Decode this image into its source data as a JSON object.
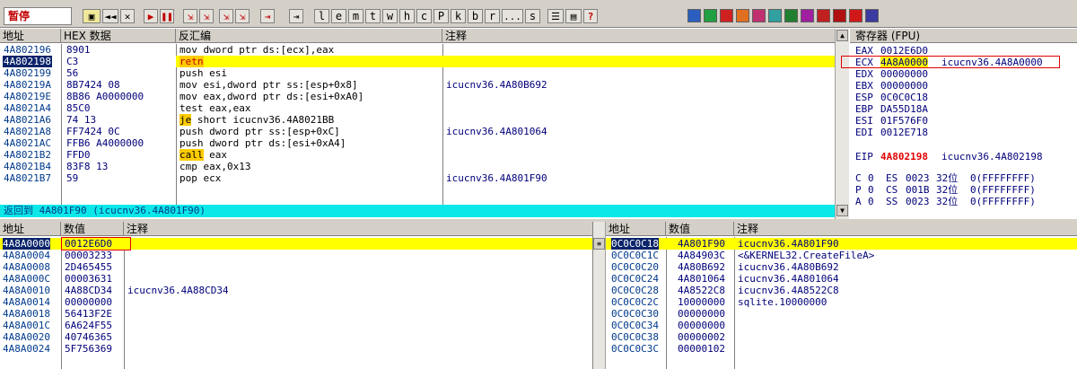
{
  "toolbar": {
    "status": "暂停",
    "buttons": [
      "◄◄",
      "✕",
      "▶",
      "❚❚",
      "⇲",
      "⇲",
      "⇲",
      "⇲",
      "⇥",
      "⇥"
    ],
    "letters": [
      "l",
      "e",
      "m",
      "t",
      "w",
      "h",
      "c",
      "P",
      "k",
      "b",
      "r",
      "...",
      "s"
    ],
    "help": "?"
  },
  "colors": {
    "highlight": "#ffff00",
    "selected": "#0a246a",
    "panel": "#d4d0c8",
    "address": "#003a8c",
    "red": "#e00000"
  },
  "disasm": {
    "headers": {
      "address": "地址",
      "hex": "HEX 数据",
      "disasm": "反汇编",
      "comment": "注释"
    },
    "rows": [
      {
        "addr": "4A802196",
        "hex": "8901",
        "asm": "mov dword ptr ds:[ecx],eax",
        "comment": ""
      },
      {
        "addr": "4A802198",
        "hex": "C3",
        "asm": "retn",
        "comment": ""
      },
      {
        "addr": "4A802199",
        "hex": "56",
        "asm": "push esi",
        "comment": ""
      },
      {
        "addr": "4A80219A",
        "hex": "8B7424 08",
        "asm": "mov esi,dword ptr ss:[esp+0x8]",
        "comment": "icucnv36.4A80B692"
      },
      {
        "addr": "4A80219E",
        "hex": "8B86 A0000000",
        "asm": "mov eax,dword ptr ds:[esi+0xA0]",
        "comment": ""
      },
      {
        "addr": "4A8021A4",
        "hex": "85C0",
        "asm": "test eax,eax",
        "comment": ""
      },
      {
        "addr": "4A8021A6",
        "hex": "74 13",
        "asm": "short icucnv36.4A8021BB",
        "kw": "je",
        "comment": ""
      },
      {
        "addr": "4A8021A8",
        "hex": "FF7424 0C",
        "asm": "push dword ptr ss:[esp+0xC]",
        "comment": "icucnv36.4A801064"
      },
      {
        "addr": "4A8021AC",
        "hex": "FFB6 A4000000",
        "asm": "push dword ptr ds:[esi+0xA4]",
        "comment": ""
      },
      {
        "addr": "4A8021B2",
        "hex": "FFD0",
        "asm": "eax",
        "kw": "call",
        "comment": ""
      },
      {
        "addr": "4A8021B4",
        "hex": "83F8 13",
        "asm": "cmp eax,0x13",
        "comment": ""
      },
      {
        "addr": "4A8021B7",
        "hex": "59",
        "asm": "pop ecx",
        "comment": "icucnv36.4A801F90"
      }
    ],
    "info": "返回到 4A801F90 (icucnv36.4A801F90)"
  },
  "registers": {
    "title": "寄存器 (FPU)",
    "regs": [
      {
        "name": "EAX",
        "value": "0012E6D0",
        "comment": ""
      },
      {
        "name": "ECX",
        "value": "4A8A0000",
        "comment": "icucnv36.4A8A0000"
      },
      {
        "name": "EDX",
        "value": "00000000",
        "comment": ""
      },
      {
        "name": "EBX",
        "value": "00000000",
        "comment": ""
      },
      {
        "name": "ESP",
        "value": "0C0C0C18",
        "comment": ""
      },
      {
        "name": "EBP",
        "value": "DA55D18A",
        "comment": ""
      },
      {
        "name": "ESI",
        "value": "01F576F0",
        "comment": ""
      },
      {
        "name": "EDI",
        "value": "0012E718",
        "comment": ""
      }
    ],
    "eip": {
      "name": "EIP",
      "value": "4A802198",
      "comment": "icucnv36.4A802198"
    },
    "flags": [
      {
        "flag": "C",
        "bit": "0",
        "seg": "ES",
        "sel": "0023",
        "size": "32位",
        "base": "0(FFFFFFFF)"
      },
      {
        "flag": "P",
        "bit": "0",
        "seg": "CS",
        "sel": "001B",
        "size": "32位",
        "base": "0(FFFFFFFF)"
      },
      {
        "flag": "A",
        "bit": "0",
        "seg": "SS",
        "sel": "0023",
        "size": "32位",
        "base": "0(FFFFFFFF)"
      }
    ]
  },
  "dump": {
    "headers": {
      "address": "地址",
      "value": "数值",
      "comment": "注释"
    },
    "rows": [
      {
        "addr": "4A8A0000",
        "value": "0012E6D0",
        "comment": ""
      },
      {
        "addr": "4A8A0004",
        "value": "00003233",
        "comment": ""
      },
      {
        "addr": "4A8A0008",
        "value": "2D465455",
        "comment": ""
      },
      {
        "addr": "4A8A000C",
        "value": "00003631",
        "comment": ""
      },
      {
        "addr": "4A8A0010",
        "value": "4A88CD34",
        "comment": "icucnv36.4A88CD34"
      },
      {
        "addr": "4A8A0014",
        "value": "00000000",
        "comment": ""
      },
      {
        "addr": "4A8A0018",
        "value": "56413F2E",
        "comment": ""
      },
      {
        "addr": "4A8A001C",
        "value": "6A624F55",
        "comment": ""
      },
      {
        "addr": "4A8A0020",
        "value": "40746365",
        "comment": ""
      },
      {
        "addr": "4A8A0024",
        "value": "5F756369",
        "comment": ""
      }
    ]
  },
  "stack": {
    "headers": {
      "address": "地址",
      "value": "数值",
      "comment": "注释"
    },
    "rows": [
      {
        "addr": "0C0C0C18",
        "value": "4A801F90",
        "comment": "icucnv36.4A801F90"
      },
      {
        "addr": "0C0C0C1C",
        "value": "4A84903C",
        "comment": "<&KERNEL32.CreateFileA>"
      },
      {
        "addr": "0C0C0C20",
        "value": "4A80B692",
        "comment": "icucnv36.4A80B692"
      },
      {
        "addr": "0C0C0C24",
        "value": "4A801064",
        "comment": "icucnv36.4A801064"
      },
      {
        "addr": "0C0C0C28",
        "value": "4A8522C8",
        "comment": "icucnv36.4A8522C8"
      },
      {
        "addr": "0C0C0C2C",
        "value": "10000000",
        "comment": "sqlite.10000000"
      },
      {
        "addr": "0C0C0C30",
        "value": "00000000",
        "comment": ""
      },
      {
        "addr": "0C0C0C34",
        "value": "00000000",
        "comment": ""
      },
      {
        "addr": "0C0C0C38",
        "value": "00000002",
        "comment": ""
      },
      {
        "addr": "0C0C0C3C",
        "value": "00000102",
        "comment": ""
      }
    ]
  }
}
